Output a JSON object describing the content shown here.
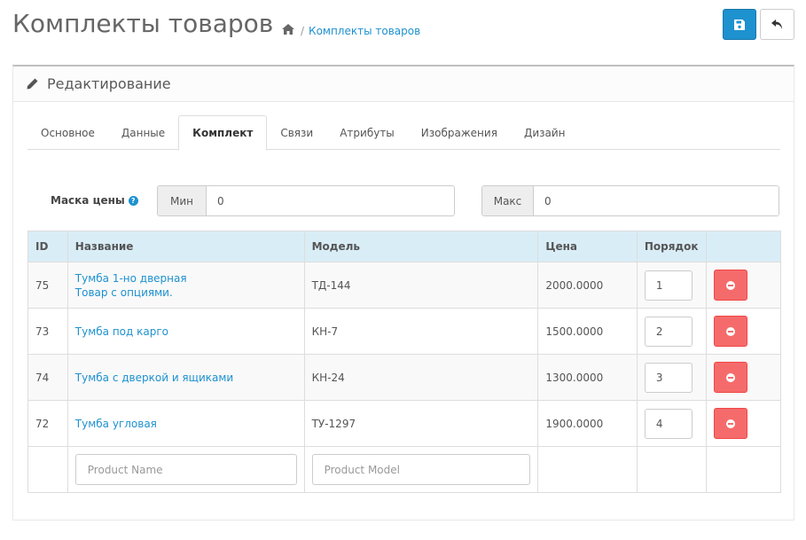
{
  "header": {
    "title": "Комплекты товаров",
    "breadcrumb": {
      "home_icon": "home-icon",
      "separator": "/",
      "current": "Комплекты товаров"
    },
    "save_icon": "floppy-icon",
    "back_icon": "reply-icon"
  },
  "panel": {
    "icon": "pencil-icon",
    "title": "Редактирование"
  },
  "tabs": [
    {
      "label": "Основное",
      "active": false
    },
    {
      "label": "Данные",
      "active": false
    },
    {
      "label": "Комплект",
      "active": true
    },
    {
      "label": "Связи",
      "active": false
    },
    {
      "label": "Атрибуты",
      "active": false
    },
    {
      "label": "Изображения",
      "active": false
    },
    {
      "label": "Дизайн",
      "active": false
    }
  ],
  "price_mask": {
    "label": "Маска цены",
    "help_icon": "?",
    "min_label": "Мин",
    "min_value": "0",
    "max_label": "Макс",
    "max_value": "0"
  },
  "table": {
    "headers": {
      "id": "ID",
      "name": "Название",
      "model": "Модель",
      "price": "Цена",
      "sort": "Порядок"
    },
    "rows": [
      {
        "id": "75",
        "name": "Тумба 1-но дверная",
        "name_note": "Товар с опциями.",
        "model": "ТД-144",
        "price": "2000.0000",
        "sort": "1"
      },
      {
        "id": "73",
        "name": "Тумба под карго",
        "name_note": "",
        "model": "КН-7",
        "price": "1500.0000",
        "sort": "2"
      },
      {
        "id": "74",
        "name": "Тумба с дверкой и ящиками",
        "name_note": "",
        "model": "КН-24",
        "price": "1300.0000",
        "sort": "3"
      },
      {
        "id": "72",
        "name": "Тумба угловая",
        "name_note": "",
        "model": "ТУ-1297",
        "price": "1900.0000",
        "sort": "4"
      }
    ],
    "add_row": {
      "name_placeholder": "Product Name",
      "model_placeholder": "Product Model"
    }
  }
}
